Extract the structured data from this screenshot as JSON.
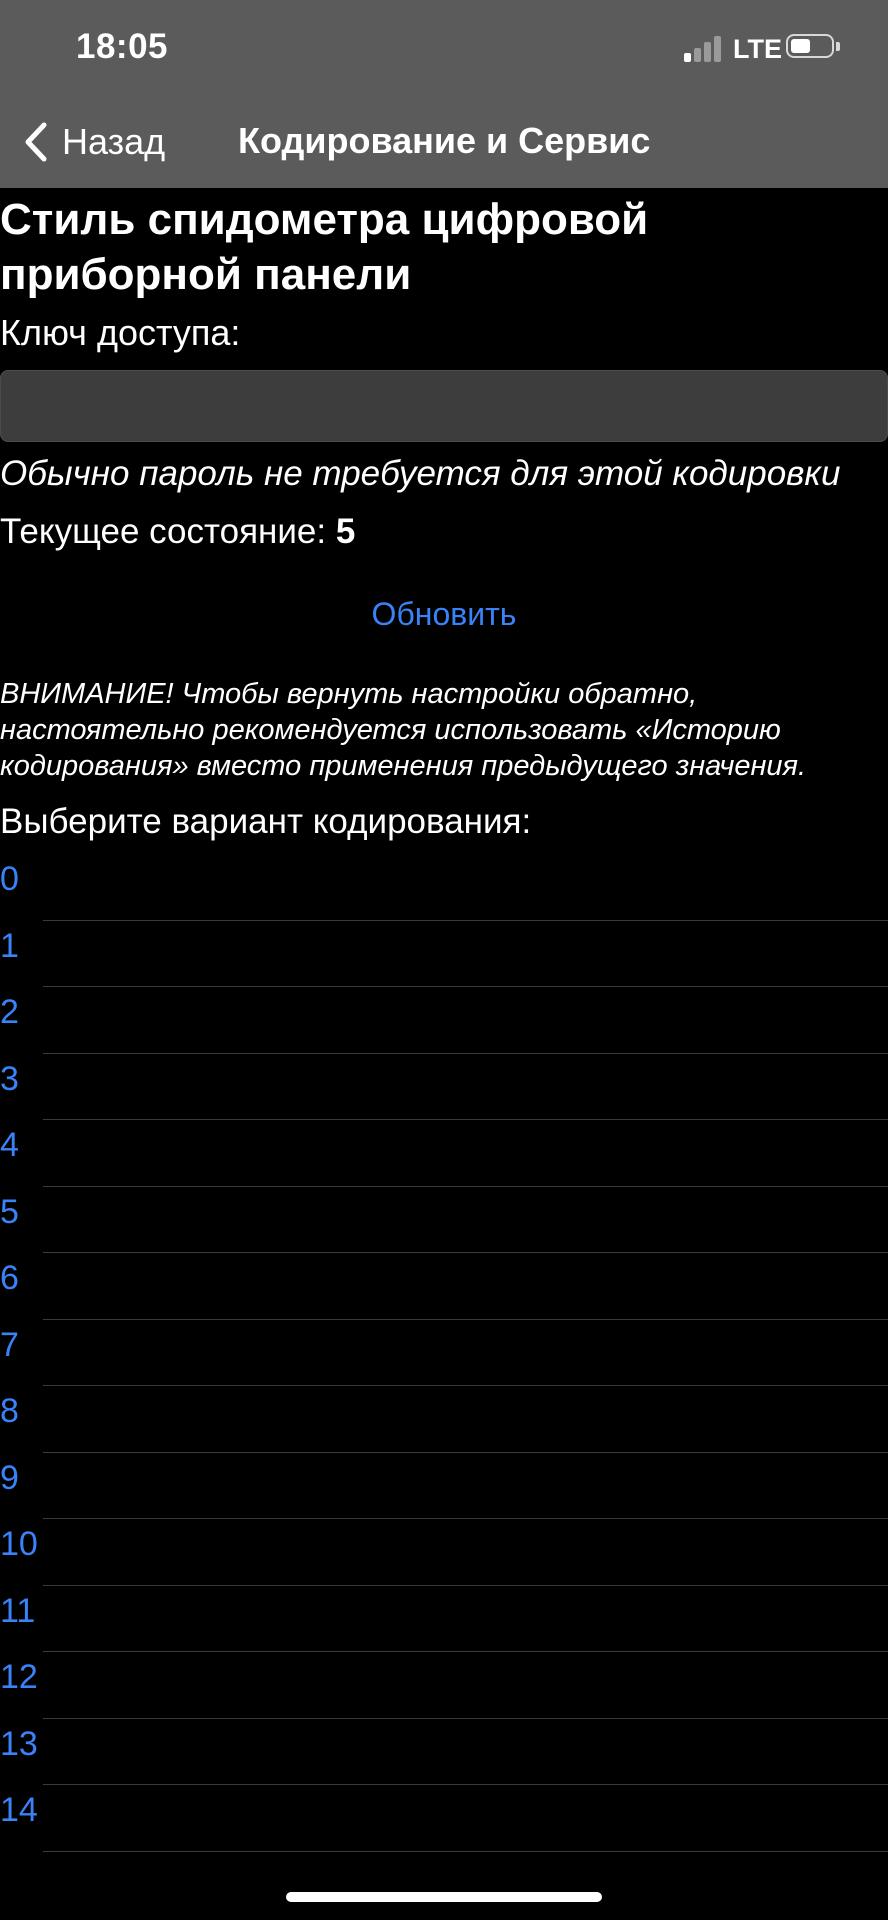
{
  "status_bar": {
    "time": "18:05",
    "network": "LTE",
    "signal_bars_active": 1,
    "signal_bars_total": 4,
    "battery_level": 0.5
  },
  "nav": {
    "back_label": "Назад",
    "title": "Кодирование и Сервис"
  },
  "page": {
    "title": "Стиль спидометра цифровой приборной панели",
    "key_label": "Ключ доступа:",
    "key_value": "",
    "hint": "Обычно пароль не требуется для этой кодировки",
    "state_label": "Текущее состояние:",
    "state_value": "5",
    "refresh_label": "Обновить",
    "warning": "ВНИМАНИЕ! Чтобы вернуть настройки обратно, настоятельно рекомендуется использовать «Историю кодирования» вместо применения предыдущего значения.",
    "choose_label": "Выберите вариант кодирования:"
  },
  "options": [
    "0",
    "1",
    "2",
    "3",
    "4",
    "5",
    "6",
    "7",
    "8",
    "9",
    "10",
    "11",
    "12",
    "13",
    "14"
  ],
  "colors": {
    "background": "#000000",
    "nav_bar": "#5b5b5b",
    "accent": "#3a82f7",
    "separator": "#3a3a3a",
    "input_background": "#3d3d3d"
  }
}
